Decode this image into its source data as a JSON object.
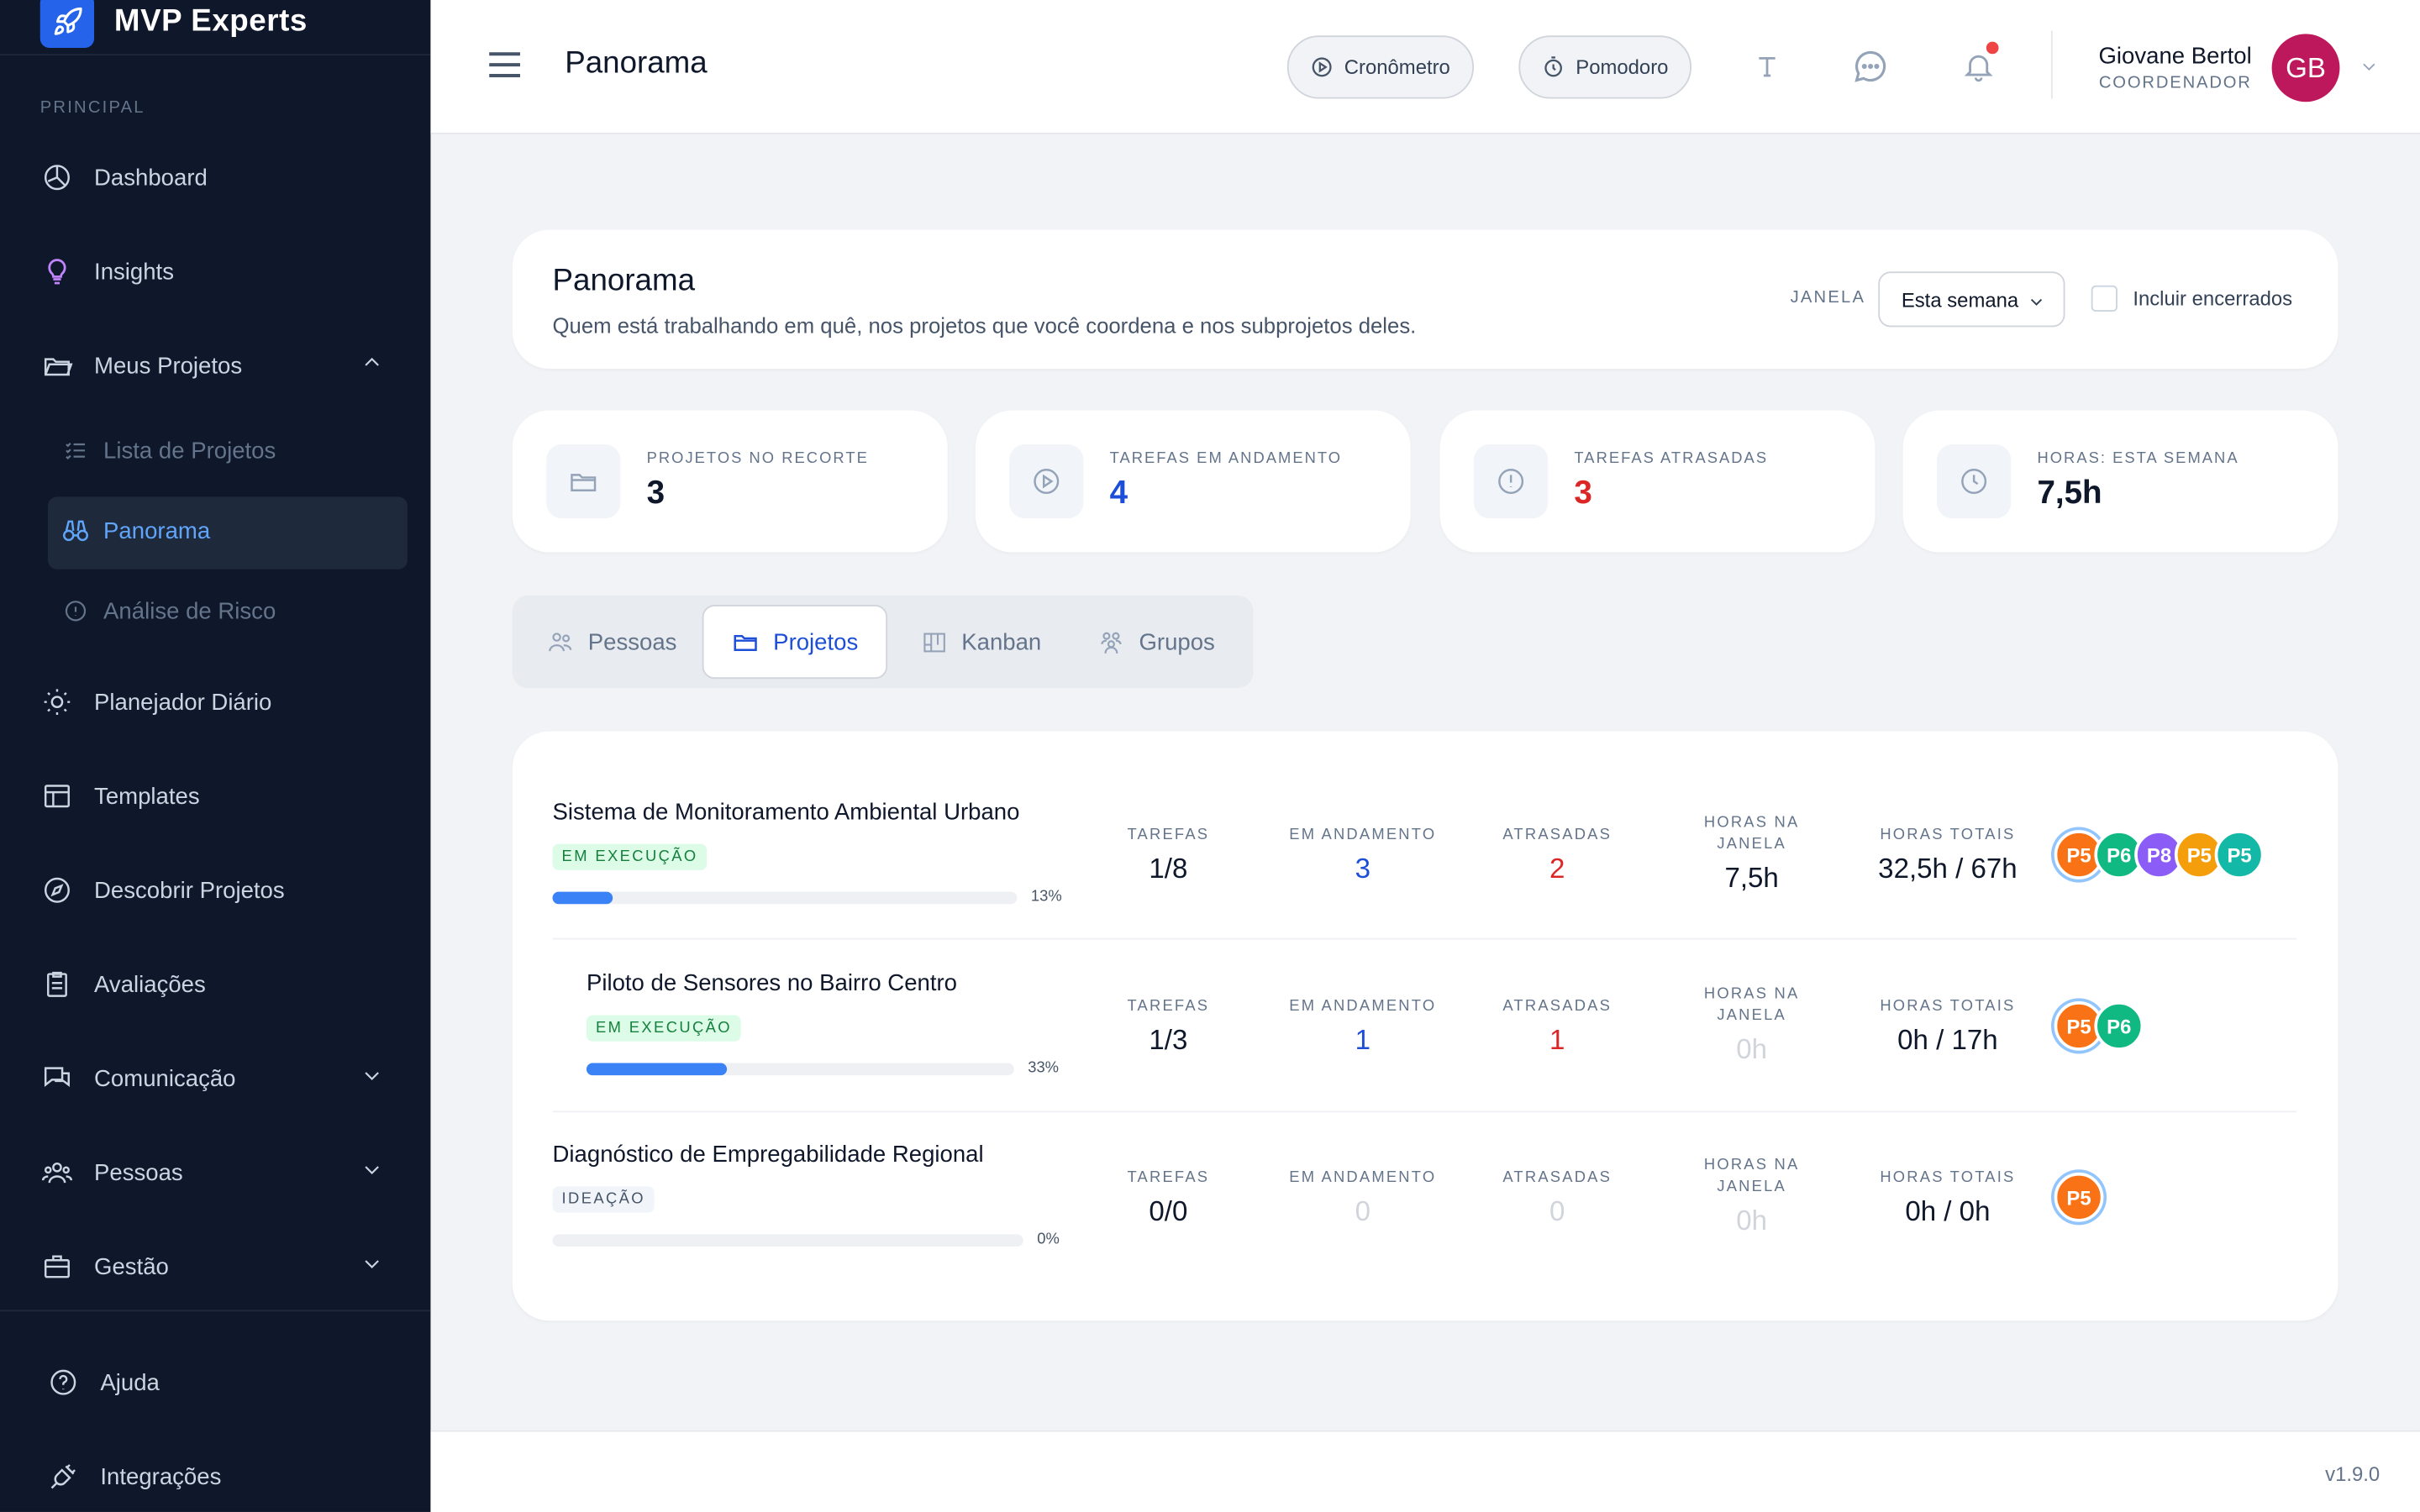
{
  "brand": {
    "name": "MVP Experts"
  },
  "sidebar": {
    "section_label": "PRINCIPAL",
    "items": [
      {
        "label": "Dashboard"
      },
      {
        "label": "Insights"
      },
      {
        "label": "Meus Projetos"
      },
      {
        "label": "Lista de Projetos"
      },
      {
        "label": "Panorama"
      },
      {
        "label": "Análise de Risco"
      },
      {
        "label": "Planejador Diário"
      },
      {
        "label": "Templates"
      },
      {
        "label": "Descobrir Projetos"
      },
      {
        "label": "Avaliações"
      },
      {
        "label": "Comunicação"
      },
      {
        "label": "Pessoas"
      },
      {
        "label": "Gestão"
      },
      {
        "label": "Ajuda"
      },
      {
        "label": "Integrações"
      }
    ]
  },
  "header": {
    "title": "Panorama",
    "cronometro": "Cronômetro",
    "pomodoro": "Pomodoro",
    "user_name": "Giovane Bertol",
    "user_role": "COORDENADOR",
    "user_initials": "GB"
  },
  "panorama": {
    "title": "Panorama",
    "subtitle": "Quem está trabalhando em quê, nos projetos que você coordena e nos subprojetos deles.",
    "janela_label": "JANELA",
    "janela_value": "Esta semana",
    "include_closed": "Incluir encerrados"
  },
  "stats": [
    {
      "label": "PROJETOS NO RECORTE",
      "value": "3",
      "color": "#0f172a"
    },
    {
      "label": "TAREFAS EM ANDAMENTO",
      "value": "4",
      "color": "#1d4ed8"
    },
    {
      "label": "TAREFAS ATRASADAS",
      "value": "3",
      "color": "#dc2626"
    },
    {
      "label": "HORAS: ESTA SEMANA",
      "value": "7,5h",
      "color": "#0f172a"
    }
  ],
  "tabs": [
    {
      "label": "Pessoas"
    },
    {
      "label": "Projetos"
    },
    {
      "label": "Kanban"
    },
    {
      "label": "Grupos"
    }
  ],
  "metric_labels": {
    "tarefas": "TAREFAS",
    "em_andamento": "EM ANDAMENTO",
    "atrasadas": "ATRASADAS",
    "horas_janela_1": "HORAS NA",
    "horas_janela_2": "JANELA",
    "horas_totais": "HORAS TOTAIS"
  },
  "projects": [
    {
      "name": "Sistema de Monitoramento Ambiental Urbano",
      "status": "EM EXECUÇÃO",
      "progress": 13,
      "progress_label": "13%",
      "tarefas": "1/8",
      "em_andamento": "3",
      "atrasadas": "2",
      "horas_janela": "7,5h",
      "horas_totais": "32,5h / 67h",
      "members": [
        "P5",
        "P6",
        "P8",
        "P5",
        "P5"
      ]
    },
    {
      "name": "Piloto de Sensores no Bairro Centro",
      "status": "EM EXECUÇÃO",
      "progress": 33,
      "progress_label": "33%",
      "tarefas": "1/3",
      "em_andamento": "1",
      "atrasadas": "1",
      "horas_janela": "0h",
      "horas_totais": "0h / 17h",
      "members": [
        "P5",
        "P6"
      ]
    },
    {
      "name": "Diagnóstico de Empregabilidade Regional",
      "status": "IDEAÇÃO",
      "progress": 0,
      "progress_label": "0%",
      "tarefas": "0/0",
      "em_andamento": "0",
      "atrasadas": "0",
      "horas_janela": "0h",
      "horas_totais": "0h / 0h",
      "members": [
        "P5"
      ]
    }
  ],
  "member_colors": {
    "P5": "#f97316",
    "P6": "#10b981",
    "P8": "#8b5cf6",
    "P5b": "#f59e0b",
    "P5c": "#14b8a6"
  },
  "footer": {
    "version": "v1.9.0"
  }
}
